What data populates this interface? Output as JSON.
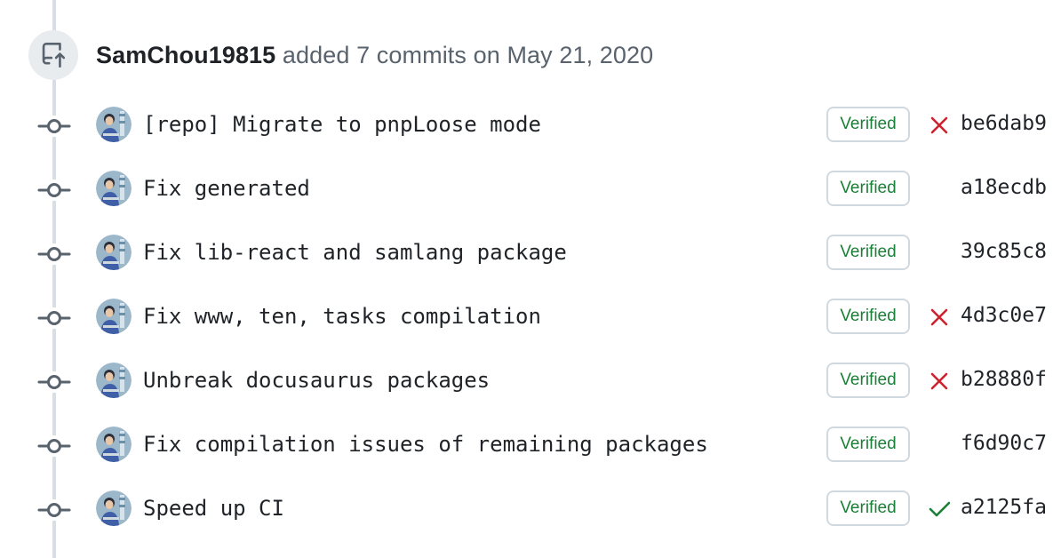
{
  "event": {
    "author": "SamChou19815",
    "action": "added 7 commits on May 21, 2020",
    "icon": "repo-push-icon"
  },
  "colors": {
    "verified_green": "#1a7f37",
    "failure_red": "#cf222e",
    "success_green": "#1a7f37",
    "timeline_gray": "#d8dee4"
  },
  "commits": [
    {
      "message": "[repo] Migrate to pnpLoose mode",
      "badge": "Verified",
      "status": "failure",
      "sha": "be6dab9"
    },
    {
      "message": "Fix generated",
      "badge": "Verified",
      "status": "none",
      "sha": "a18ecdb"
    },
    {
      "message": "Fix lib-react and samlang package",
      "badge": "Verified",
      "status": "none",
      "sha": "39c85c8"
    },
    {
      "message": "Fix www, ten, tasks compilation",
      "badge": "Verified",
      "status": "failure",
      "sha": "4d3c0e7"
    },
    {
      "message": "Unbreak docusaurus packages",
      "badge": "Verified",
      "status": "failure",
      "sha": "b28880f"
    },
    {
      "message": "Fix compilation issues of remaining packages",
      "badge": "Verified",
      "status": "none",
      "sha": "f6d90c7"
    },
    {
      "message": "Speed up CI",
      "badge": "Verified",
      "status": "success",
      "sha": "a2125fa"
    }
  ]
}
